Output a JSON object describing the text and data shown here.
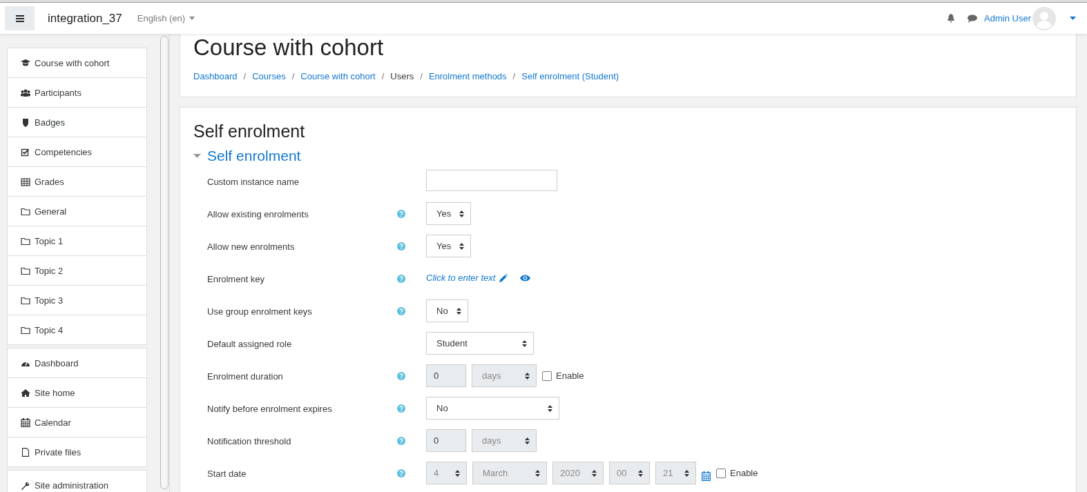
{
  "navbar": {
    "site_name": "integration_37",
    "language": "English (en)",
    "user_name": "Admin User"
  },
  "sidebar": {
    "groups": [
      {
        "items": [
          {
            "label": "Course with cohort"
          },
          {
            "label": "Participants"
          },
          {
            "label": "Badges"
          },
          {
            "label": "Competencies"
          },
          {
            "label": "Grades"
          },
          {
            "label": "General"
          },
          {
            "label": "Topic 1"
          },
          {
            "label": "Topic 2"
          },
          {
            "label": "Topic 3"
          },
          {
            "label": "Topic 4"
          }
        ]
      },
      {
        "items": [
          {
            "label": "Dashboard"
          },
          {
            "label": "Site home"
          },
          {
            "label": "Calendar"
          },
          {
            "label": "Private files"
          }
        ]
      },
      {
        "items": [
          {
            "label": "Site administration"
          }
        ]
      }
    ]
  },
  "header": {
    "title": "Course with cohort",
    "separator": "/",
    "breadcrumbs": [
      {
        "label": "Dashboard",
        "link": true
      },
      {
        "label": "Courses",
        "link": true
      },
      {
        "label": "Course with cohort",
        "link": true
      },
      {
        "label": "Users",
        "link": false
      },
      {
        "label": "Enrolment methods",
        "link": true
      },
      {
        "label": "Self enrolment (Student)",
        "link": true
      }
    ]
  },
  "form": {
    "title": "Self enrolment",
    "section": {
      "title": "Self enrolment",
      "expanded": true
    },
    "fields": [
      {
        "kind": "text",
        "label": "Custom instance name",
        "help": false
      },
      {
        "kind": "select",
        "label": "Allow existing enrolments",
        "help": true,
        "value": "Yes",
        "disabled": false
      },
      {
        "kind": "select",
        "label": "Allow new enrolments",
        "help": true,
        "value": "Yes",
        "disabled": false
      },
      {
        "kind": "inplace",
        "label": "Enrolment key",
        "help": true,
        "text": "Click to enter text"
      },
      {
        "kind": "select",
        "label": "Use group enrolment keys",
        "help": true,
        "value": "No",
        "disabled": false
      },
      {
        "kind": "select",
        "label": "Default assigned role",
        "help": false,
        "value": "Student",
        "disabled": false
      },
      {
        "kind": "duration",
        "label": "Enrolment duration",
        "help": true,
        "number": "0",
        "unit": "days",
        "disabled": true,
        "enable": {
          "label": "Enable",
          "checked": false
        }
      },
      {
        "kind": "select",
        "label": "Notify before enrolment expires",
        "help": true,
        "value": "No",
        "disabled": false
      },
      {
        "kind": "duration",
        "label": "Notification threshold",
        "help": true,
        "number": "0",
        "unit": "days",
        "disabled": true
      },
      {
        "kind": "date",
        "label": "Start date",
        "help": true,
        "parts": [
          "4",
          "March",
          "2020",
          "00",
          "21"
        ],
        "disabled": true,
        "enable": {
          "label": "Enable",
          "checked": false
        }
      }
    ]
  }
}
